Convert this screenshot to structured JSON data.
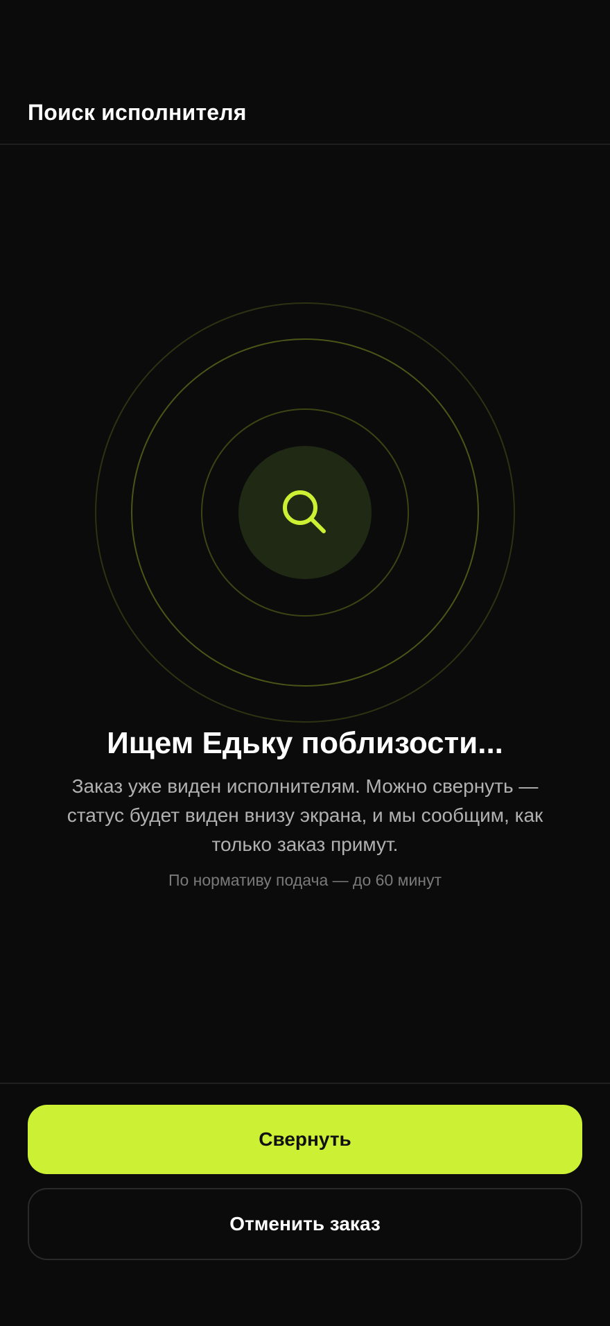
{
  "header": {
    "title": "Поиск исполнителя"
  },
  "search": {
    "icon": "search-icon",
    "title": "Ищем Едьку поблизости...",
    "description": "Заказ уже виден исполнителям. Можно свернуть — статус будет виден внизу экрана, и мы сообщим, как только заказ примут.",
    "note": "По нормативу подача — до 60 минут"
  },
  "actions": {
    "collapse_label": "Свернуть",
    "cancel_label": "Отменить заказ"
  },
  "colors": {
    "background": "#0b0b0b",
    "accent": "#ccf034",
    "core": "#202914",
    "text_secondary": "#b1b1b1",
    "text_muted": "#7a7a7a"
  }
}
